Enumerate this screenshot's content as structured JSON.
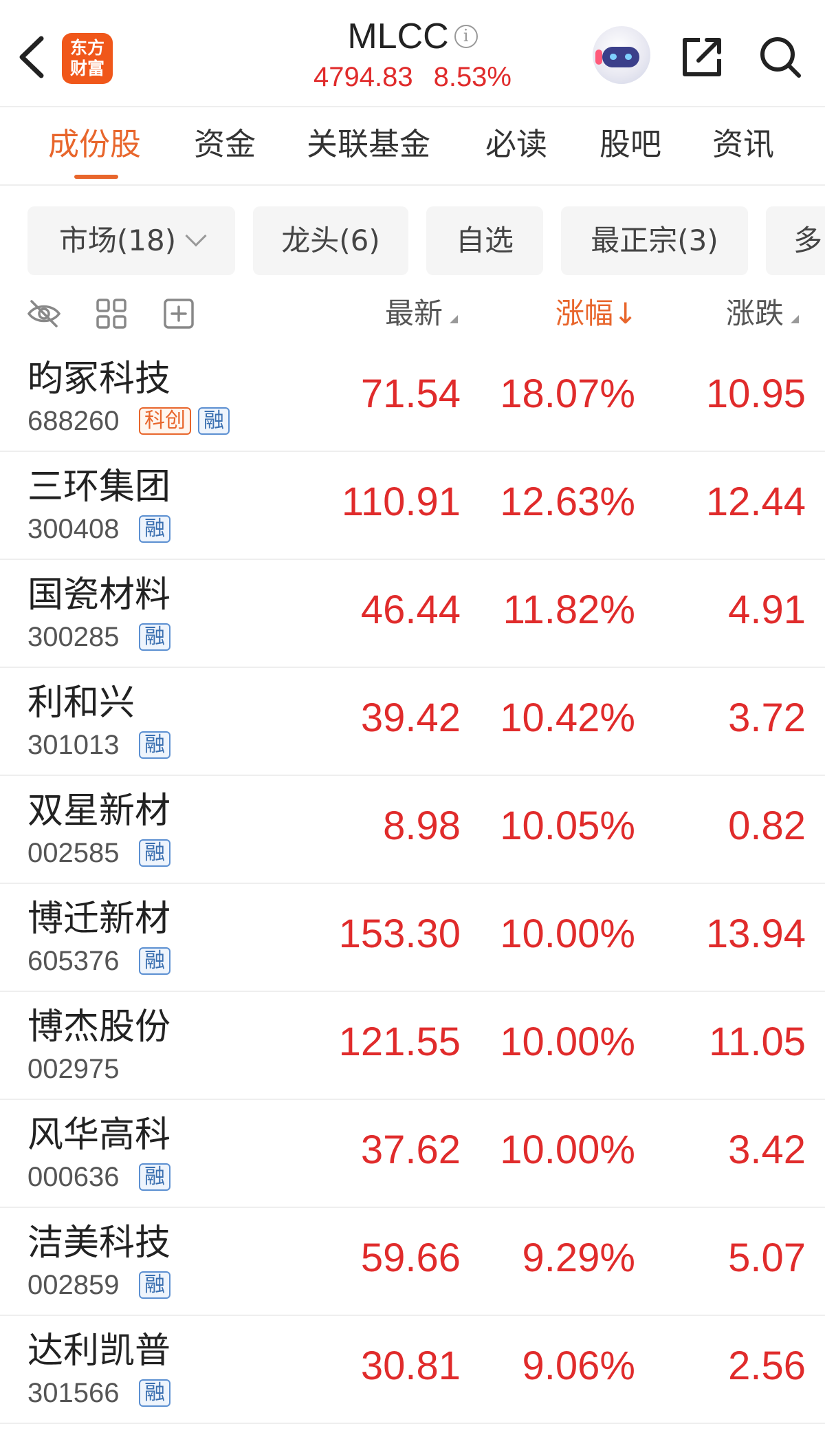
{
  "header": {
    "logo_line1": "东方",
    "logo_line2": "财富",
    "title": "MLCC",
    "info_glyph": "i",
    "index_value": "4794.83",
    "index_change_pct": "8.53%",
    "icons": [
      "back-icon",
      "info-icon",
      "robot-avatar-icon",
      "share-icon",
      "search-icon"
    ]
  },
  "tabs": [
    {
      "label": "成份股",
      "active": true
    },
    {
      "label": "资金",
      "active": false
    },
    {
      "label": "关联基金",
      "active": false
    },
    {
      "label": "必读",
      "active": false
    },
    {
      "label": "股吧",
      "active": false
    },
    {
      "label": "资讯",
      "active": false
    }
  ],
  "filters": [
    {
      "label": "市场(18)"
    },
    {
      "label": "龙头(6)"
    },
    {
      "label": "自选"
    },
    {
      "label": "最正宗(3)"
    },
    {
      "label": "多"
    }
  ],
  "columns": {
    "latest": "最新",
    "change_pct": "涨幅",
    "change_pct_arrow": "↓",
    "change": "涨跌"
  },
  "colors": {
    "accent": "#e8662c",
    "up": "#e02b2b",
    "rong_badge": "#3a6fb0"
  },
  "stocks": [
    {
      "name": "昀冢科技",
      "code": "688260",
      "badges": [
        "科创",
        "融"
      ],
      "price": "71.54",
      "pct": "18.07%",
      "chg": "10.95"
    },
    {
      "name": "三环集团",
      "code": "300408",
      "badges": [
        "融"
      ],
      "price": "110.91",
      "pct": "12.63%",
      "chg": "12.44"
    },
    {
      "name": "国瓷材料",
      "code": "300285",
      "badges": [
        "融"
      ],
      "price": "46.44",
      "pct": "11.82%",
      "chg": "4.91"
    },
    {
      "name": "利和兴",
      "code": "301013",
      "badges": [
        "融"
      ],
      "price": "39.42",
      "pct": "10.42%",
      "chg": "3.72"
    },
    {
      "name": "双星新材",
      "code": "002585",
      "badges": [
        "融"
      ],
      "price": "8.98",
      "pct": "10.05%",
      "chg": "0.82"
    },
    {
      "name": "博迁新材",
      "code": "605376",
      "badges": [
        "融"
      ],
      "price": "153.30",
      "pct": "10.00%",
      "chg": "13.94"
    },
    {
      "name": "博杰股份",
      "code": "002975",
      "badges": [],
      "price": "121.55",
      "pct": "10.00%",
      "chg": "11.05"
    },
    {
      "name": "风华高科",
      "code": "000636",
      "badges": [
        "融"
      ],
      "price": "37.62",
      "pct": "10.00%",
      "chg": "3.42"
    },
    {
      "name": "洁美科技",
      "code": "002859",
      "badges": [
        "融"
      ],
      "price": "59.66",
      "pct": "9.29%",
      "chg": "5.07"
    },
    {
      "name": "达利凯普",
      "code": "301566",
      "badges": [
        "融"
      ],
      "price": "30.81",
      "pct": "9.06%",
      "chg": "2.56"
    }
  ]
}
